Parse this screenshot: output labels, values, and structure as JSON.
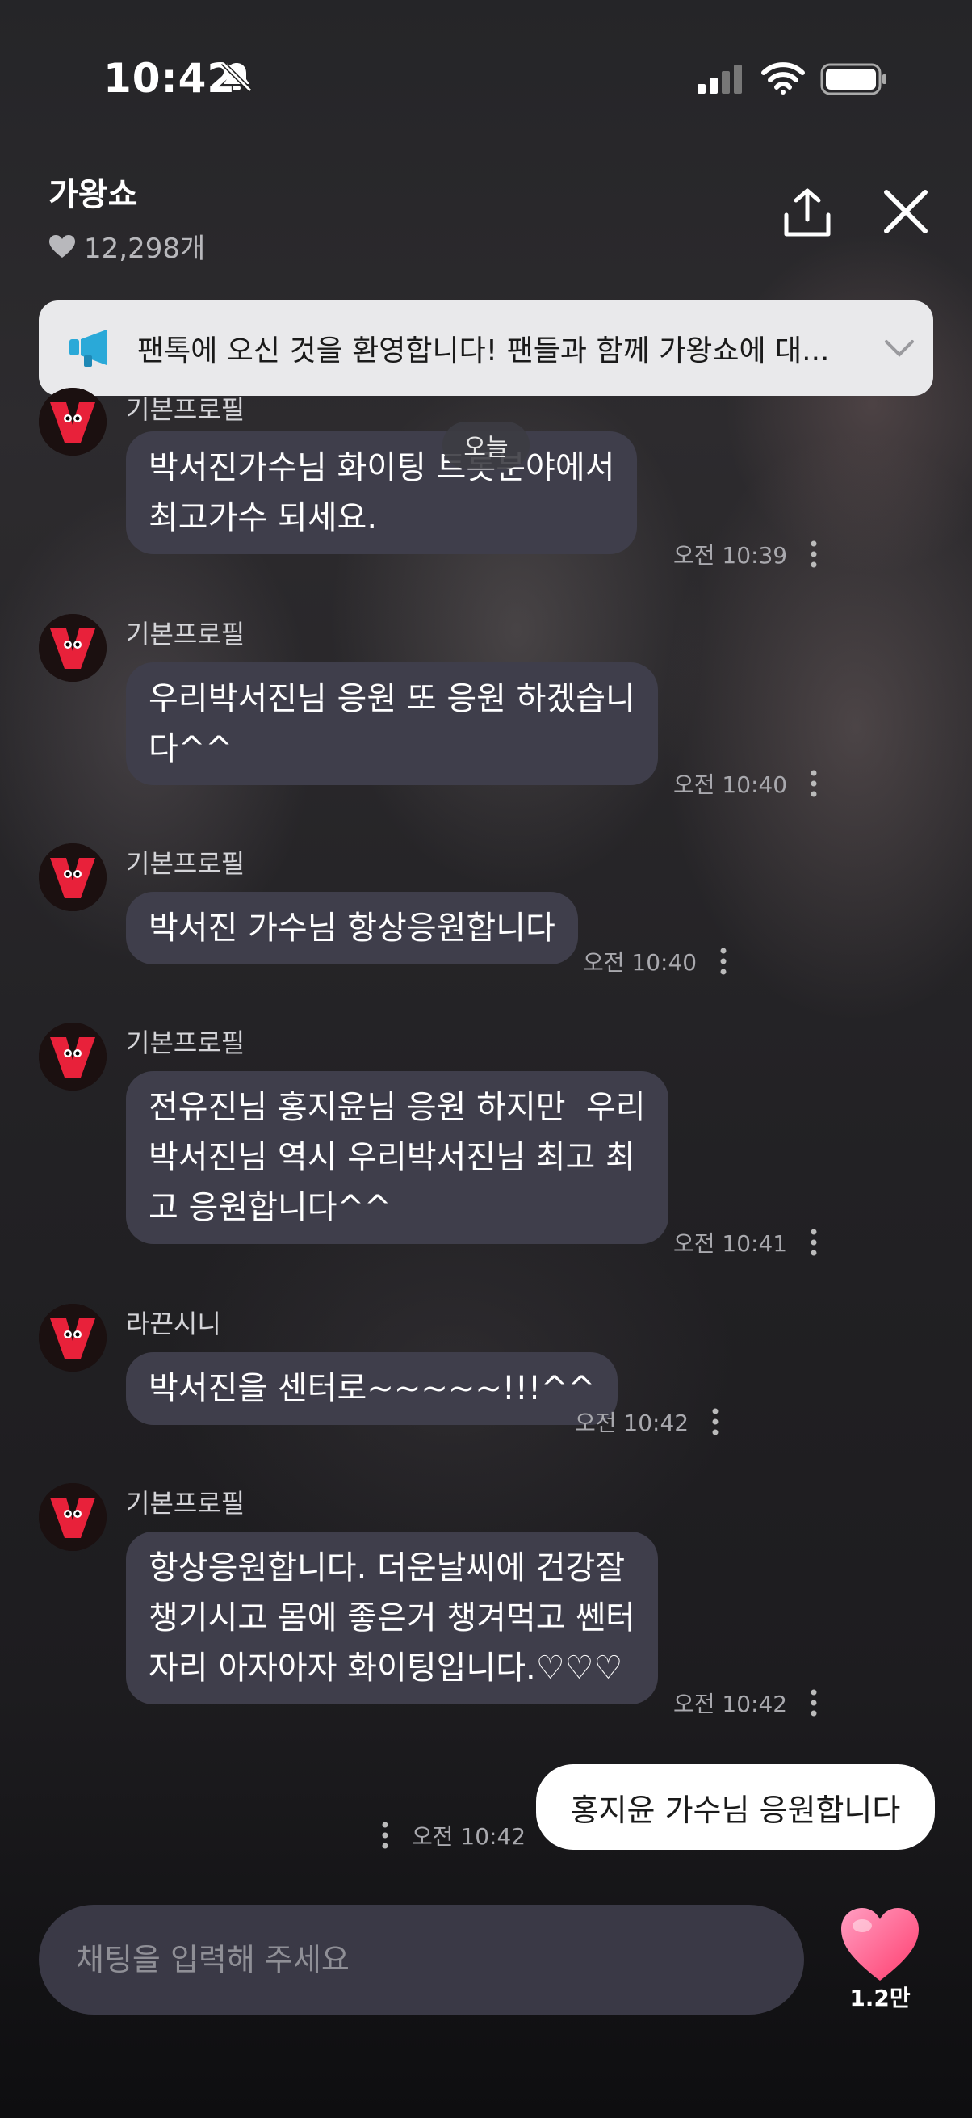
{
  "status": {
    "time": "10:42"
  },
  "header": {
    "title": "가왕쇼",
    "likes": "12,298개"
  },
  "notice": {
    "text": "팬톡에 오신 것을 환영합니다! 팬들과 함께 가왕쇼에 대..."
  },
  "date_chip": "오늘",
  "messages": [
    {
      "sender": "기본프로필",
      "text": "박서진가수님 화이팅 트롯분야에서\n최고가수 되세요.",
      "time": "오전 10:39"
    },
    {
      "sender": "기본프로필",
      "text": "우리박서진님 응원 또 응원 하겠습니\n다^^",
      "time": "오전 10:40"
    },
    {
      "sender": "기본프로필",
      "text": "박서진 가수님 항상응원합니다",
      "time": "오전 10:40"
    },
    {
      "sender": "기본프로필",
      "text": "전유진님 홍지윤님 응원 하지만  우리\n박서진님 역시 우리박서진님 최고 최\n고 응원합니다^^",
      "time": "오전 10:41"
    },
    {
      "sender": "라끈시니",
      "text": "박서진을 센터로~~~~~!!!^^",
      "time": "오전 10:42"
    },
    {
      "sender": "기본프로필",
      "text": "항상응원합니다. 더운날씨에 건강잘\n챙기시고 몸에 좋은거 챙겨먹고 쎈터\n자리 아자아자 화이팅입니다.♡♡♡",
      "time": "오전 10:42"
    }
  ],
  "my_message": {
    "text": "홍지윤 가수님 응원합니다",
    "time": "오전 10:42"
  },
  "input": {
    "placeholder": "채팅을 입력해 주세요"
  },
  "like_button": {
    "count": "1.2만"
  },
  "colors": {
    "bubble": "#3f3e4b",
    "accent_heart": "#ff4d7a",
    "notice_icon": "#2aa9d8"
  }
}
